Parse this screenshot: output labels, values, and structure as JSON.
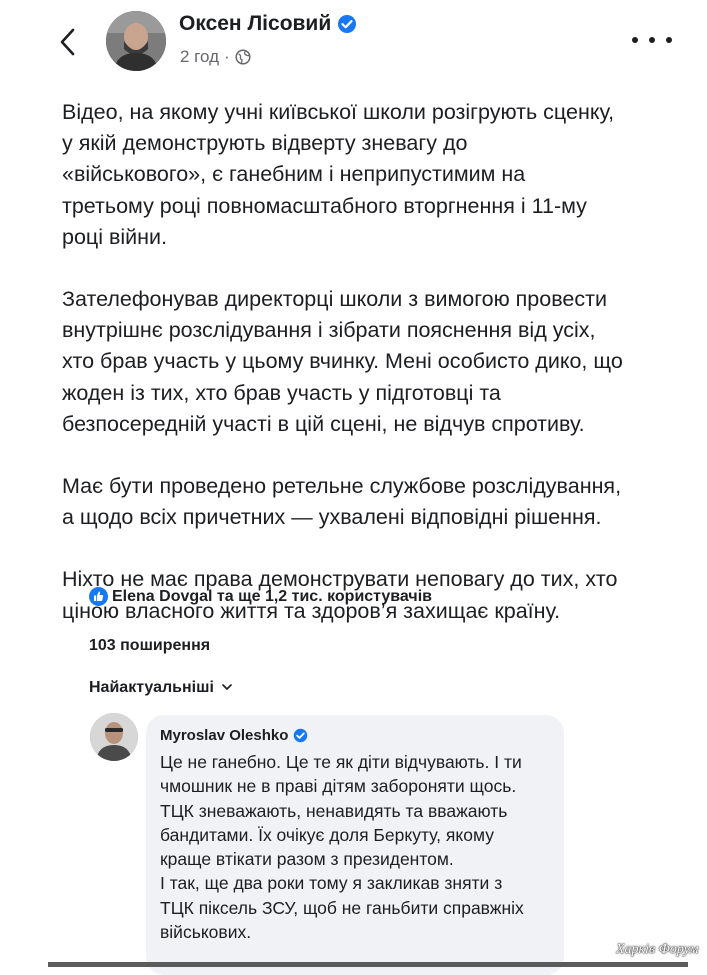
{
  "header": {
    "back_icon": "chevron-left-icon",
    "author_name": "Оксен Лісовий",
    "time": "2 год",
    "separator": "·",
    "audience_icon": "globe-icon",
    "more_icon": "more-horizontal-icon"
  },
  "post": {
    "paragraphs": [
      "Відео, на якому учні київської школи розігрують сценку,\nу якій демонструють відверту зневагу до\n«військового», є ганебним і неприпустимим на\nтретьому році повномасштабного вторгнення і 11-му\nроці війни.",
      "Зателефонував директорці школи з вимогою провести\nвнутрішнє розслідування і зібрати пояснення від усіх,\nхто брав участь у цьому вчинку. Мені особисто дико, що\nжоден із тих, хто брав участь у підготовці та\nбезпосередній участі в цій сцені, не відчув спротиву.",
      "Має бути проведено ретельне службове розслідування,\nа щодо всіх причетних —  ухвалені відповідні рішення.",
      "Ніхто не має права демонструвати неповагу до тих, хто\nціною власного життя та здоров’я захищає країну."
    ]
  },
  "engagement": {
    "reactions_text": "Elena Dovgal та ще 1,2 тис. користувачів",
    "shares_text": "103 поширення",
    "sort_label": "Найактуальніші",
    "sort_chevron": "⌄"
  },
  "comment": {
    "author": "Myroslav Oleshko",
    "text": "Це не ганебно. Це те як діти відчувають. І ти\nчмошник не в праві дітям забороняти щось.\nТЦК зневажають, ненавидять та вважають\nбандитами. Їх очікує доля Беркуту, якому\nкраще втікати разом з президентом.\nІ так, ще два роки тому я закликав зняти з\nТЦК піксель ЗСУ, щоб не ганьбити справжніх\nвійськових."
  },
  "watermark": "Харків Форум",
  "colors": {
    "verified_blue": "#1877f2",
    "text": "#1c1e21",
    "secondary_text": "#65676b",
    "comment_bg": "#f0f2f5"
  }
}
